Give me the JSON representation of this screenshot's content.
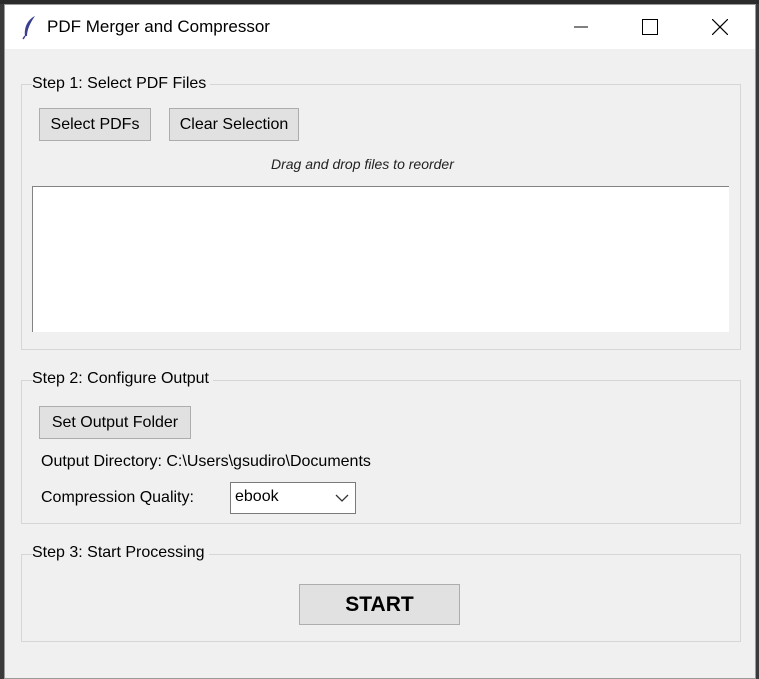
{
  "window": {
    "title": "PDF Merger and Compressor",
    "app_icon": "feather-icon",
    "controls": [
      "minimize-icon",
      "maximize-icon",
      "close-icon"
    ]
  },
  "step1": {
    "title": "Step 1: Select PDF Files",
    "select_button": "Select PDFs",
    "clear_button": "Clear Selection",
    "hint": "Drag and drop files to reorder",
    "files": []
  },
  "step2": {
    "title": "Step 2: Configure Output",
    "output_button": "Set Output Folder",
    "output_directory": "Output Directory: C:\\Users\\gsudiro\\Documents",
    "compression_label": "Compression Quality:",
    "compression_value": "ebook"
  },
  "step3": {
    "title": "Step 3: Start Processing",
    "start_button": "START"
  }
}
